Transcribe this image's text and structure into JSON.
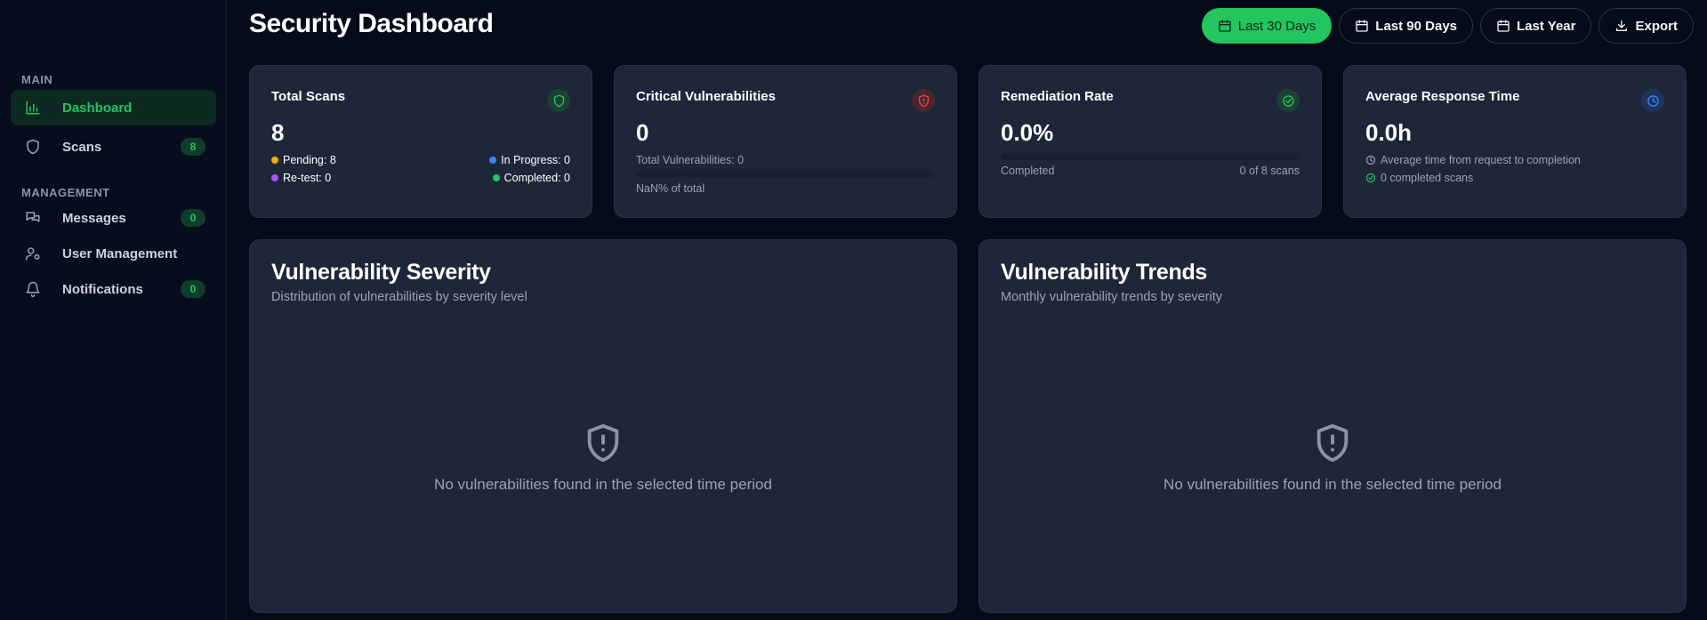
{
  "sidebar": {
    "sections": [
      {
        "label": "MAIN"
      },
      {
        "label": "MANAGEMENT"
      }
    ],
    "items": [
      {
        "label": "Dashboard",
        "icon": "bar-chart-icon",
        "active": true
      },
      {
        "label": "Scans",
        "icon": "shield-icon",
        "badge": "8"
      },
      {
        "label": "Messages",
        "icon": "messages-icon",
        "badge": "0"
      },
      {
        "label": "User Management",
        "icon": "user-cog-icon"
      },
      {
        "label": "Notifications",
        "icon": "bell-icon",
        "badge": "0"
      }
    ]
  },
  "header": {
    "title": "Security Dashboard",
    "buttons": [
      {
        "label": "Last 30 Days",
        "icon": "calendar-icon",
        "active": true
      },
      {
        "label": "Last 90 Days",
        "icon": "calendar-icon"
      },
      {
        "label": "Last Year",
        "icon": "calendar-icon"
      },
      {
        "label": "Export",
        "icon": "download-icon"
      }
    ]
  },
  "cards": {
    "total_scans": {
      "title": "Total Scans",
      "value": "8",
      "pending": "Pending: 8",
      "in_progress": "In Progress: 0",
      "retest": "Re-test: 0",
      "completed": "Completed: 0"
    },
    "critical": {
      "title": "Critical Vulnerabilities",
      "value": "0",
      "total": "Total Vulnerabilities: 0",
      "percent": "NaN% of total",
      "fill_fraction": 0
    },
    "remediation": {
      "title": "Remediation Rate",
      "value": "0.0%",
      "left_label": "Completed",
      "right_label": "0 of 8 scans",
      "fill_fraction": 0
    },
    "response": {
      "title": "Average Response Time",
      "value": "0.0h",
      "line1": "Average time from request to completion",
      "line2": "0 completed scans"
    }
  },
  "panels": {
    "severity": {
      "title": "Vulnerability Severity",
      "subtitle": "Distribution of vulnerabilities by severity level",
      "empty": "No vulnerabilities found in the selected time period"
    },
    "trends": {
      "title": "Vulnerability Trends",
      "subtitle": "Monthly vulnerability trends by severity",
      "empty": "No vulnerabilities found in the selected time period"
    }
  },
  "colors": {
    "accent": "#22c55e",
    "pending": "#eab308",
    "in_progress": "#3b82f6",
    "retest": "#a855f7",
    "completed": "#22c55e",
    "critical": "#ef4444"
  }
}
